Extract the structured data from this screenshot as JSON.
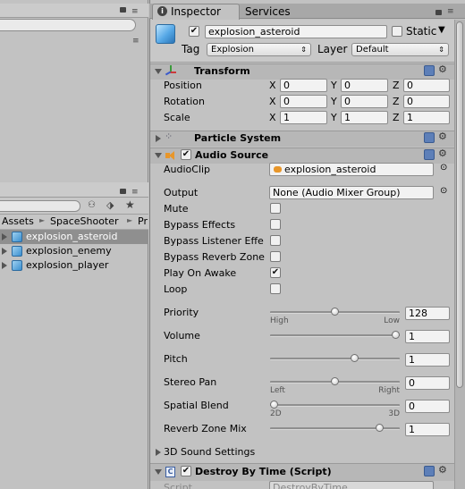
{
  "left_panel": {
    "breadcrumb": [
      "Assets",
      "SpaceShooter",
      "Pr"
    ],
    "assets": [
      {
        "label": "explosion_asteroid",
        "selected": true
      },
      {
        "label": "explosion_enemy",
        "selected": false
      },
      {
        "label": "explosion_player",
        "selected": false
      }
    ]
  },
  "tabs": {
    "inspector": "Inspector",
    "services": "Services"
  },
  "object": {
    "name": "explosion_asteroid",
    "active": true,
    "static_label": "Static",
    "tag_label": "Tag",
    "tag_value": "Explosion",
    "layer_label": "Layer",
    "layer_value": "Default"
  },
  "transform": {
    "title": "Transform",
    "rows": [
      {
        "label": "Position",
        "x": "0",
        "y": "0",
        "z": "0"
      },
      {
        "label": "Rotation",
        "x": "0",
        "y": "0",
        "z": "0"
      },
      {
        "label": "Scale",
        "x": "1",
        "y": "1",
        "z": "1"
      }
    ],
    "axis_x": "X",
    "axis_y": "Y",
    "axis_z": "Z"
  },
  "particle_system": {
    "title": "Particle System"
  },
  "audio_source": {
    "title": "Audio Source",
    "enabled": true,
    "audioclip_label": "AudioClip",
    "audioclip_value": "explosion_asteroid",
    "output_label": "Output",
    "output_value": "None (Audio Mixer Group)",
    "toggles": [
      {
        "label": "Mute",
        "checked": false
      },
      {
        "label": "Bypass Effects",
        "checked": false
      },
      {
        "label": "Bypass Listener Effe",
        "checked": false
      },
      {
        "label": "Bypass Reverb Zone",
        "checked": false
      },
      {
        "label": "Play On Awake",
        "checked": true
      },
      {
        "label": "Loop",
        "checked": false
      }
    ],
    "sliders": [
      {
        "label": "Priority",
        "value": "128",
        "fraction": 0.5,
        "left": "High",
        "right": "Low"
      },
      {
        "label": "Volume",
        "value": "1",
        "fraction": 1.0,
        "left": "",
        "right": ""
      },
      {
        "label": "Pitch",
        "value": "1",
        "fraction": 0.66,
        "left": "",
        "right": ""
      },
      {
        "label": "Stereo Pan",
        "value": "0",
        "fraction": 0.5,
        "left": "Left",
        "right": "Right"
      },
      {
        "label": "Spatial Blend",
        "value": "0",
        "fraction": 0.0,
        "left": "2D",
        "right": "3D"
      },
      {
        "label": "Reverb Zone Mix",
        "value": "1",
        "fraction": 0.87,
        "left": "",
        "right": ""
      }
    ],
    "sound_settings": "3D Sound Settings"
  },
  "destroy_by_time": {
    "title": "Destroy By Time (Script)",
    "script_label": "Script",
    "script_value": "DestroyByTime"
  },
  "icons": {
    "check": "✔",
    "dropdown": "▾",
    "lock": "lock-icon",
    "menu": "menu-icon",
    "help": "help-icon",
    "gear": "gear-icon"
  }
}
